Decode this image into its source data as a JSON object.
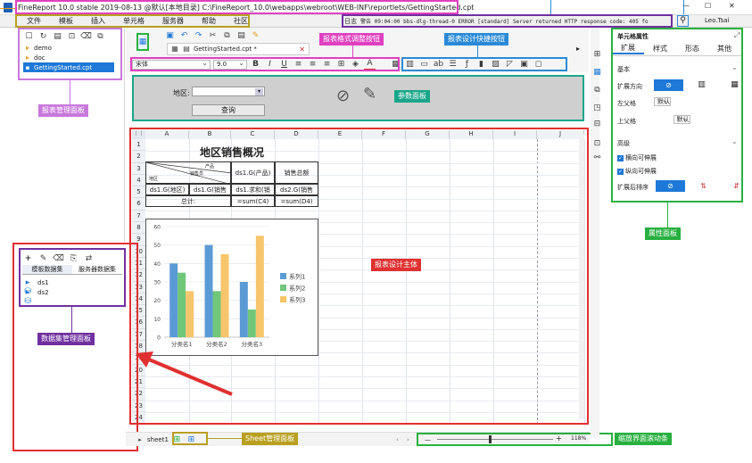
{
  "title_bar": {
    "title": "FineReport 10.0 stable 2019-08-13 @默认[本地目录]   C:\\FineReport_10.0\\webapps\\webroot\\WEB-INF\\reportlets/GettingStarted.cpt",
    "minimize": "—",
    "maximize": "☐",
    "close": "✕"
  },
  "menu": {
    "items": [
      "文件",
      "模板",
      "插入",
      "单元格",
      "服务器",
      "帮助",
      "社区"
    ],
    "log_label": "日志",
    "log_message": "警告 09:04:00 bbs-dlg-thread-0 ERROR [standard] Server returned HTTP response code: 405 fo",
    "user": "Leo.Tsai"
  },
  "template_panel": {
    "items": [
      "demo",
      "doc",
      "GettingStarted.cpt"
    ],
    "selected": "GettingStarted.cpt"
  },
  "editor": {
    "tab_label": "GettingStarted.cpt *",
    "font_name": "宋体",
    "font_size": "9.0"
  },
  "param_panel": {
    "region_label": "地区:",
    "query_button": "查询"
  },
  "grid": {
    "columns": [
      "A",
      "B",
      "C",
      "D",
      "E",
      "F",
      "G",
      "H",
      "I",
      "J"
    ],
    "rows": [
      "1",
      "2",
      "3",
      "4",
      "5",
      "6",
      "7",
      "8",
      "9",
      "10",
      "11",
      "12",
      "13",
      "14",
      "15",
      "16",
      "17",
      "18",
      "19",
      "20",
      "21",
      "22",
      "23",
      "24"
    ],
    "report_title": "地区销售概况",
    "header_product": "产品",
    "header_salesperson": "销售员",
    "header_region": "地区",
    "header_c3": "ds1.G(产品)",
    "header_d3": "销售总额",
    "a4": "ds1.G(地区)",
    "b4": "ds1.G(销售",
    "c4": "ds1.求和(销",
    "d4": "ds2.G(销售",
    "total_label": "总计:",
    "c5": "=sum(C4)",
    "d5": "=sum(D4)"
  },
  "chart_data": {
    "type": "bar",
    "categories": [
      "分类名1",
      "分类名2",
      "分类名3"
    ],
    "series": [
      {
        "name": "系列1",
        "values": [
          40,
          50,
          30
        ],
        "color": "#5b9bd5"
      },
      {
        "name": "系列2",
        "values": [
          35,
          25,
          15
        ],
        "color": "#70c77a"
      },
      {
        "name": "系列3",
        "values": [
          25,
          45,
          55
        ],
        "color": "#f7c56b"
      }
    ],
    "ylim": [
      0,
      60
    ],
    "yticks": [
      "0",
      "10",
      "20",
      "30",
      "40",
      "50",
      "60"
    ],
    "legend_position": "right",
    "grid": true
  },
  "dataset_panel": {
    "tabs": [
      "模板数据集",
      "服务器数据集"
    ],
    "items": [
      "ds1",
      "ds2"
    ]
  },
  "sheet_bar": {
    "sheet_name": "sheet1",
    "zoom": "118%",
    "zoom_minus": "—",
    "zoom_plus": "+"
  },
  "property_panel": {
    "title": "单元格属性",
    "tabs": [
      "扩展",
      "样式",
      "形态",
      "其他"
    ],
    "section_basic": "基本",
    "expand_direction": "扩展方向",
    "left_parent": "左父格",
    "upper_parent": "上父格",
    "default_value": "默认",
    "section_advanced": "高级",
    "horizontal_stretch": "横向可伸展",
    "vertical_stretch": "纵向可伸展",
    "sort_after_expand": "扩展后排序"
  },
  "annotations": {
    "template_mgmt": "报表管理面板",
    "format_buttons": "报表格式调整按钮",
    "design_shortcuts": "报表设计快捷按钮",
    "param_panel": "参数面板",
    "design_body": "报表设计主体",
    "property_panel": "属性面板",
    "dataset_panel": "数据集管理面板",
    "sheet_panel": "Sheet管理面板",
    "zoom_bar": "缩放界面滚动条"
  },
  "colors": {
    "pink": "#e040c0",
    "red": "#e03030",
    "teal": "#1aa68a",
    "blue": "#2a8ad8",
    "green": "#28b040",
    "olive": "#b9a020",
    "purple": "#7030a0",
    "lilac": "#c878dc"
  }
}
